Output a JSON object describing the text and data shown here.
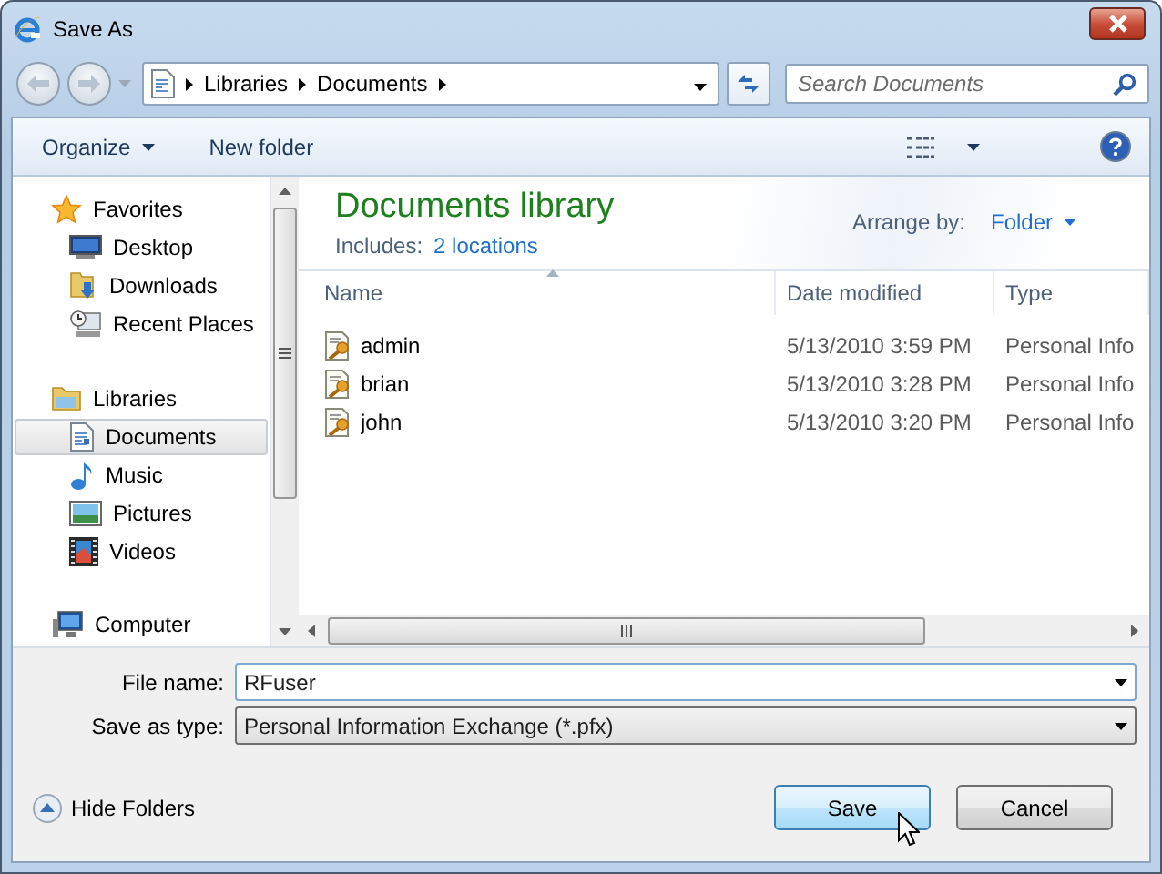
{
  "window": {
    "title": "Save As"
  },
  "address": {
    "crumbs": [
      "Libraries",
      "Documents"
    ]
  },
  "search": {
    "placeholder": "Search Documents"
  },
  "toolbar": {
    "organize": "Organize",
    "new_folder": "New folder"
  },
  "sidebar": {
    "groups": [
      {
        "label": "Favorites",
        "selected": false,
        "children": [
          {
            "label": "Desktop",
            "selected": false
          },
          {
            "label": "Downloads",
            "selected": false
          },
          {
            "label": "Recent Places",
            "selected": false
          }
        ]
      },
      {
        "label": "Libraries",
        "selected": false,
        "children": [
          {
            "label": "Documents",
            "selected": true
          },
          {
            "label": "Music",
            "selected": false
          },
          {
            "label": "Pictures",
            "selected": false
          },
          {
            "label": "Videos",
            "selected": false
          }
        ]
      },
      {
        "label": "Computer",
        "selected": false
      }
    ]
  },
  "library": {
    "title": "Documents library",
    "includes_label": "Includes:",
    "includes_link": "2 locations",
    "arrange_label": "Arrange by:",
    "arrange_value": "Folder"
  },
  "table": {
    "columns": [
      "Name",
      "Date modified",
      "Type"
    ],
    "rows": [
      {
        "name": "admin",
        "date": "5/13/2010 3:59 PM",
        "type": "Personal Info"
      },
      {
        "name": "brian",
        "date": "5/13/2010 3:28 PM",
        "type": "Personal Info"
      },
      {
        "name": "john",
        "date": "5/13/2010 3:20 PM",
        "type": "Personal Info"
      }
    ]
  },
  "form": {
    "file_name_label": "File name:",
    "file_name": "RFuser",
    "type_label": "Save as type:",
    "type_value": "Personal Information Exchange (*.pfx)"
  },
  "hide_folders": "Hide Folders",
  "buttons": {
    "save": "Save",
    "cancel": "Cancel"
  }
}
